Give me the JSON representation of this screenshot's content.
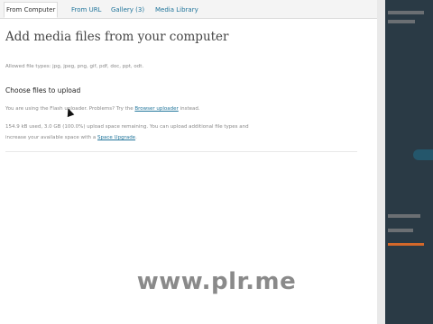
{
  "tabs": [
    {
      "label": "From Computer",
      "active": true
    },
    {
      "label": "From URL",
      "active": false
    },
    {
      "label": "Gallery (3)",
      "active": false
    },
    {
      "label": "Media Library",
      "active": false
    }
  ],
  "heading": "Add media files from your computer",
  "allowed_types": "Allowed file types: jpg, jpeg, png, gif, pdf, doc, ppt, odt.",
  "choose_label": "Choose files to upload",
  "uploader_note": {
    "before": "You are using the Flash uploader. Problems? Try the ",
    "link": "Browser uploader",
    "after": " instead."
  },
  "space_note": {
    "line1": "154.9 kB used, 3.0 GB (100.0%) upload space remaining. You can upload additional file types and",
    "line2_before": "increase your available space with a ",
    "line2_link": "Space Upgrade",
    "line2_after": "."
  },
  "watermark": "www.plr.me",
  "colors": {
    "link": "#21759b",
    "side_panel": "#2a3a45",
    "accent_orange": "#d4682a"
  }
}
